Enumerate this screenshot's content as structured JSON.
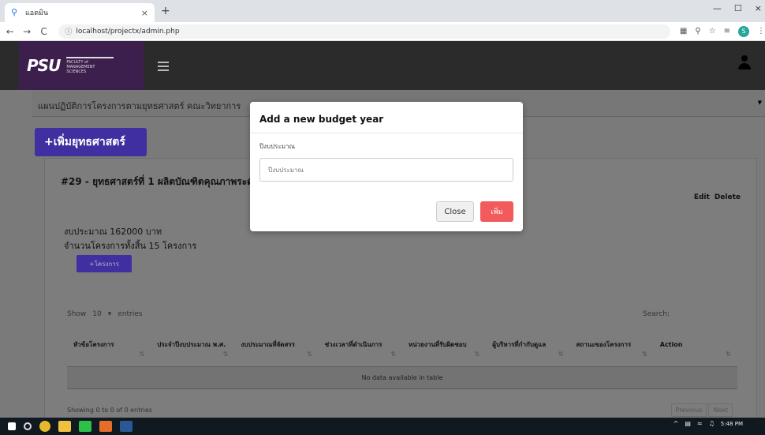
{
  "browser": {
    "tab_title": "แอดมิน",
    "tab_close": "×",
    "new_tab": "+",
    "url": "localhost/projectx/admin.php",
    "nav": {
      "back": "←",
      "forward": "→",
      "reload": "C"
    },
    "window_controls": {
      "minimize": "—",
      "maximize": "☐",
      "close": "×"
    },
    "profile_initial": "S"
  },
  "header": {
    "logo_text": "PSU",
    "logo_subtitle": "FACULTY of MANAGEMENT SCIENCES"
  },
  "breadcrumb": "แผนปฏิบัติการโครงการตามยุทธศาสตร์ คณะวิทยาการ",
  "add_strategy_label": "+เพิ่มยุทธศาสตร์",
  "card": {
    "title": "#29 - ยุทธศาสตร์ที่ 1 ผลิตบัณฑิตคุณภาพระดับ",
    "edit_label": "Edit",
    "delete_label": "Delete",
    "budget_line": "งบประมาณ 162000 บาท",
    "projects_line": "จำนวนโครงการทั้งสิ้น 15 โครงการ",
    "add_project_label": "+โครงการ"
  },
  "table": {
    "show_label": "Show",
    "show_value": "10",
    "entries_label": "entries",
    "search_label": "Search:",
    "columns": [
      "หัวข้อโครงการ",
      "ประจำปีงบประมาณ พ.ศ.",
      "งบประมาณที่จัดสรร",
      "ช่วงเวลาที่ดำเนินการ",
      "หน่วยงานที่รับผิดชอบ",
      "ผู้บริหารที่กำกับดูแล",
      "สถานะของโครงการ",
      "Action"
    ],
    "empty_message": "No data available in table",
    "showing_text": "Showing 0 to 0 of 0 entries",
    "previous_label": "Previous",
    "next_label": "Next"
  },
  "modal": {
    "title": "Add a new budget year",
    "field_label": "ปีงบประมาณ",
    "field_placeholder": "ปีงบประมาณ",
    "close_label": "Close",
    "submit_label": "เพิ่ม"
  },
  "taskbar": {
    "time": "5:48 PM"
  },
  "colors": {
    "accent_purple": "#3f2fa0",
    "submit_red": "#f15b5b",
    "logo_bg": "#3d1f4d"
  }
}
